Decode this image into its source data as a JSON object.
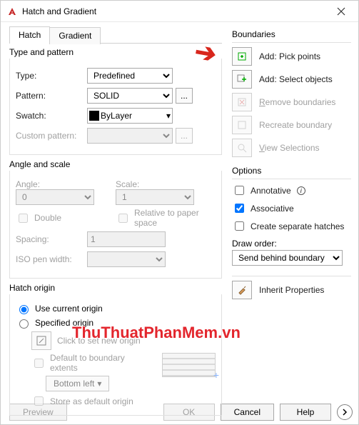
{
  "window": {
    "title": "Hatch and Gradient"
  },
  "tabs": {
    "hatch": "Hatch",
    "gradient": "Gradient"
  },
  "type_pattern": {
    "legend": "Type and pattern",
    "type_label": "Type:",
    "type_value": "Predefined",
    "pattern_label": "Pattern:",
    "pattern_value": "SOLID",
    "swatch_label": "Swatch:",
    "swatch_value": "ByLayer",
    "custom_label": "Custom pattern:",
    "ellipsis": "..."
  },
  "angle_scale": {
    "legend": "Angle and scale",
    "angle_label": "Angle:",
    "angle_value": "0",
    "scale_label": "Scale:",
    "scale_value": "1",
    "double_label": "Double",
    "relative_label": "Relative to paper space",
    "spacing_label": "Spacing:",
    "spacing_value": "1",
    "iso_label": "ISO pen width:"
  },
  "origin": {
    "legend": "Hatch origin",
    "use_current": "Use current origin",
    "specified": "Specified origin",
    "click_set": "Click to set new origin",
    "default_to": "Default to boundary extents",
    "bottom_left": "Bottom left",
    "store_default": "Store as default origin"
  },
  "boundaries": {
    "legend": "Boundaries",
    "pick_points": "Add: Pick points",
    "select_objects": "Add: Select objects",
    "remove": "Remove boundaries",
    "recreate": "Recreate boundary",
    "view_sel": "View Selections"
  },
  "options": {
    "legend": "Options",
    "annotative": "Annotative",
    "associative": "Associative",
    "create_sep": "Create separate hatches",
    "draw_order_label": "Draw order:",
    "draw_order_value": "Send behind boundary"
  },
  "inherit": {
    "label": "Inherit Properties"
  },
  "footer": {
    "preview": "Preview",
    "ok": "OK",
    "cancel": "Cancel",
    "help": "Help"
  },
  "watermark": "ThuThuatPhanMem.vn"
}
